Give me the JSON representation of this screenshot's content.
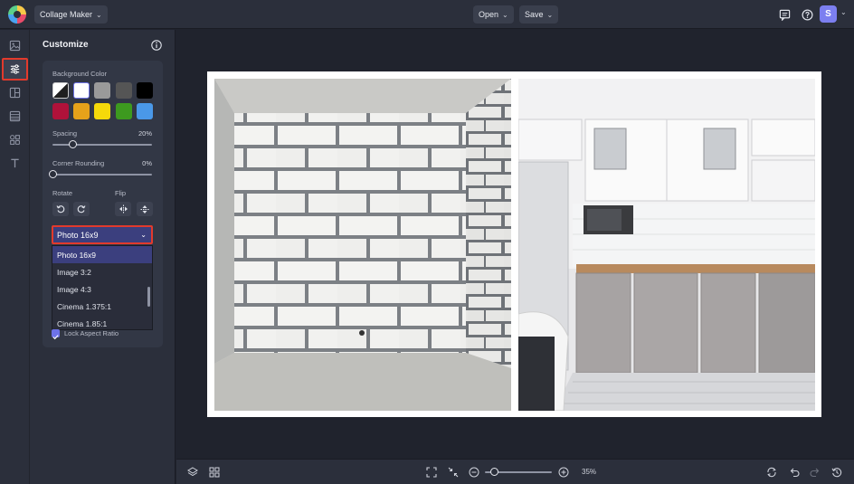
{
  "topbar": {
    "app_menu_label": "Collage Maker",
    "open_label": "Open",
    "save_label": "Save",
    "avatar_initial": "S",
    "icons": [
      "comment-icon",
      "help-icon",
      "chevron-down-icon"
    ]
  },
  "rail": {
    "items": [
      {
        "name": "image-icon",
        "active": false
      },
      {
        "name": "sliders-icon",
        "active": true
      },
      {
        "name": "layout-icon",
        "active": false
      },
      {
        "name": "grid-list-icon",
        "active": false
      },
      {
        "name": "elements-icon",
        "active": false
      },
      {
        "name": "text-icon",
        "active": false
      }
    ]
  },
  "panel": {
    "title": "Customize",
    "background_color_label": "Background Color",
    "swatches": [
      "transparent-toggle",
      "#ffffff",
      "#9a9a9a",
      "#555555",
      "#000000",
      "#b0123a",
      "#e6a21a",
      "#f5d90a",
      "#3d9a1f",
      "#4a98e8"
    ],
    "spacing_label": "Spacing",
    "spacing_value": "20%",
    "spacing_level": 0.2,
    "corner_label": "Corner Rounding",
    "corner_value": "0%",
    "corner_level": 0.0,
    "rotate_label": "Rotate",
    "flip_label": "Flip",
    "aspect_select": {
      "selected": "Photo 16x9",
      "options": [
        "Photo 16x9",
        "Image 3:2",
        "Image 4:3",
        "Cinema 1.375:1",
        "Cinema 1.85:1"
      ]
    },
    "lock_aspect_label": "Lock Aspect Ratio",
    "lock_aspect_checked": true
  },
  "bottombar": {
    "zoom_value": "35%",
    "zoom_level": 0.35
  },
  "colors": {
    "accent": "#6d72e8",
    "highlight_border": "#e23a2c",
    "background": "#20232d",
    "panel": "#2b2f3b"
  }
}
